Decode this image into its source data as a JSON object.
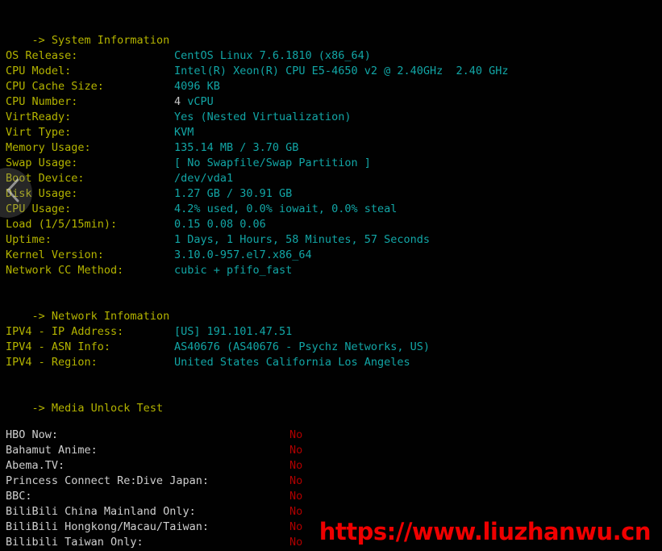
{
  "theme": {
    "background": "#010101",
    "label_color": "#b4b400",
    "value_color": "#12a6a6",
    "plain_color": "#c8c8c8",
    "media_label_color": "#cfcfcf",
    "media_value_color": "#b00000",
    "watermark_color": "#ef0000"
  },
  "sections": {
    "system": {
      "heading": "-> System Information",
      "rows": [
        {
          "label": "OS Release:",
          "value": "CentOS Linux 7.6.1810 (x86_64)"
        },
        {
          "label": "CPU Model:",
          "value": "Intel(R) Xeon(R) CPU E5-4650 v2 @ 2.40GHz  2.40 GHz"
        },
        {
          "label": "CPU Cache Size:",
          "value": "4096 KB"
        },
        {
          "label": "CPU Number:",
          "value_plain": "4 ",
          "value": "vCPU"
        },
        {
          "label": "VirtReady:",
          "value": "Yes (Nested Virtualization)"
        },
        {
          "label": "Virt Type:",
          "value": "KVM"
        },
        {
          "label": "Memory Usage:",
          "value": "135.14 MB / 3.70 GB"
        },
        {
          "label": "Swap Usage:",
          "value": "[ No Swapfile/Swap Partition ]"
        },
        {
          "label": "Boot Device:",
          "value": "/dev/vda1"
        },
        {
          "label": "Disk Usage:",
          "value": "1.27 GB / 30.91 GB"
        },
        {
          "label": "CPU Usage:",
          "value": "4.2% used, 0.0% iowait, 0.0% steal"
        },
        {
          "label": "Load (1/5/15min):",
          "value": "0.15 0.08 0.06"
        },
        {
          "label": "Uptime:",
          "value": "1 Days, 1 Hours, 58 Minutes, 57 Seconds"
        },
        {
          "label": "Kernel Version:",
          "value": "3.10.0-957.el7.x86_64"
        },
        {
          "label": "Network CC Method:",
          "value": "cubic + pfifo_fast"
        }
      ]
    },
    "network": {
      "heading": "-> Network Infomation",
      "rows": [
        {
          "label": "IPV4 - IP Address:",
          "value": "[US] 191.101.47.51"
        },
        {
          "label": "IPV4 - ASN Info:",
          "value": "AS40676 (AS40676 - Psychz Networks, US)"
        },
        {
          "label": "IPV4 - Region:",
          "value": "United States California Los Angeles"
        }
      ]
    },
    "media": {
      "heading": "-> Media Unlock Test",
      "rows": [
        {
          "label": "HBO Now:",
          "value": "No"
        },
        {
          "label": "Bahamut Anime:",
          "value": "No"
        },
        {
          "label": "Abema.TV:",
          "value": "No"
        },
        {
          "label": "Princess Connect Re:Dive Japan:",
          "value": "No"
        },
        {
          "label": "BBC:",
          "value": "No"
        },
        {
          "label": "BiliBili China Mainland Only:",
          "value": "No"
        },
        {
          "label": "BiliBili Hongkong/Macau/Taiwan:",
          "value": "No"
        },
        {
          "label": "Bilibili Taiwan Only:",
          "value": "No"
        }
      ]
    }
  },
  "carousel": {
    "prev_label": "previous"
  },
  "watermark": {
    "text": "https://www.liuzhanwu.cn"
  }
}
